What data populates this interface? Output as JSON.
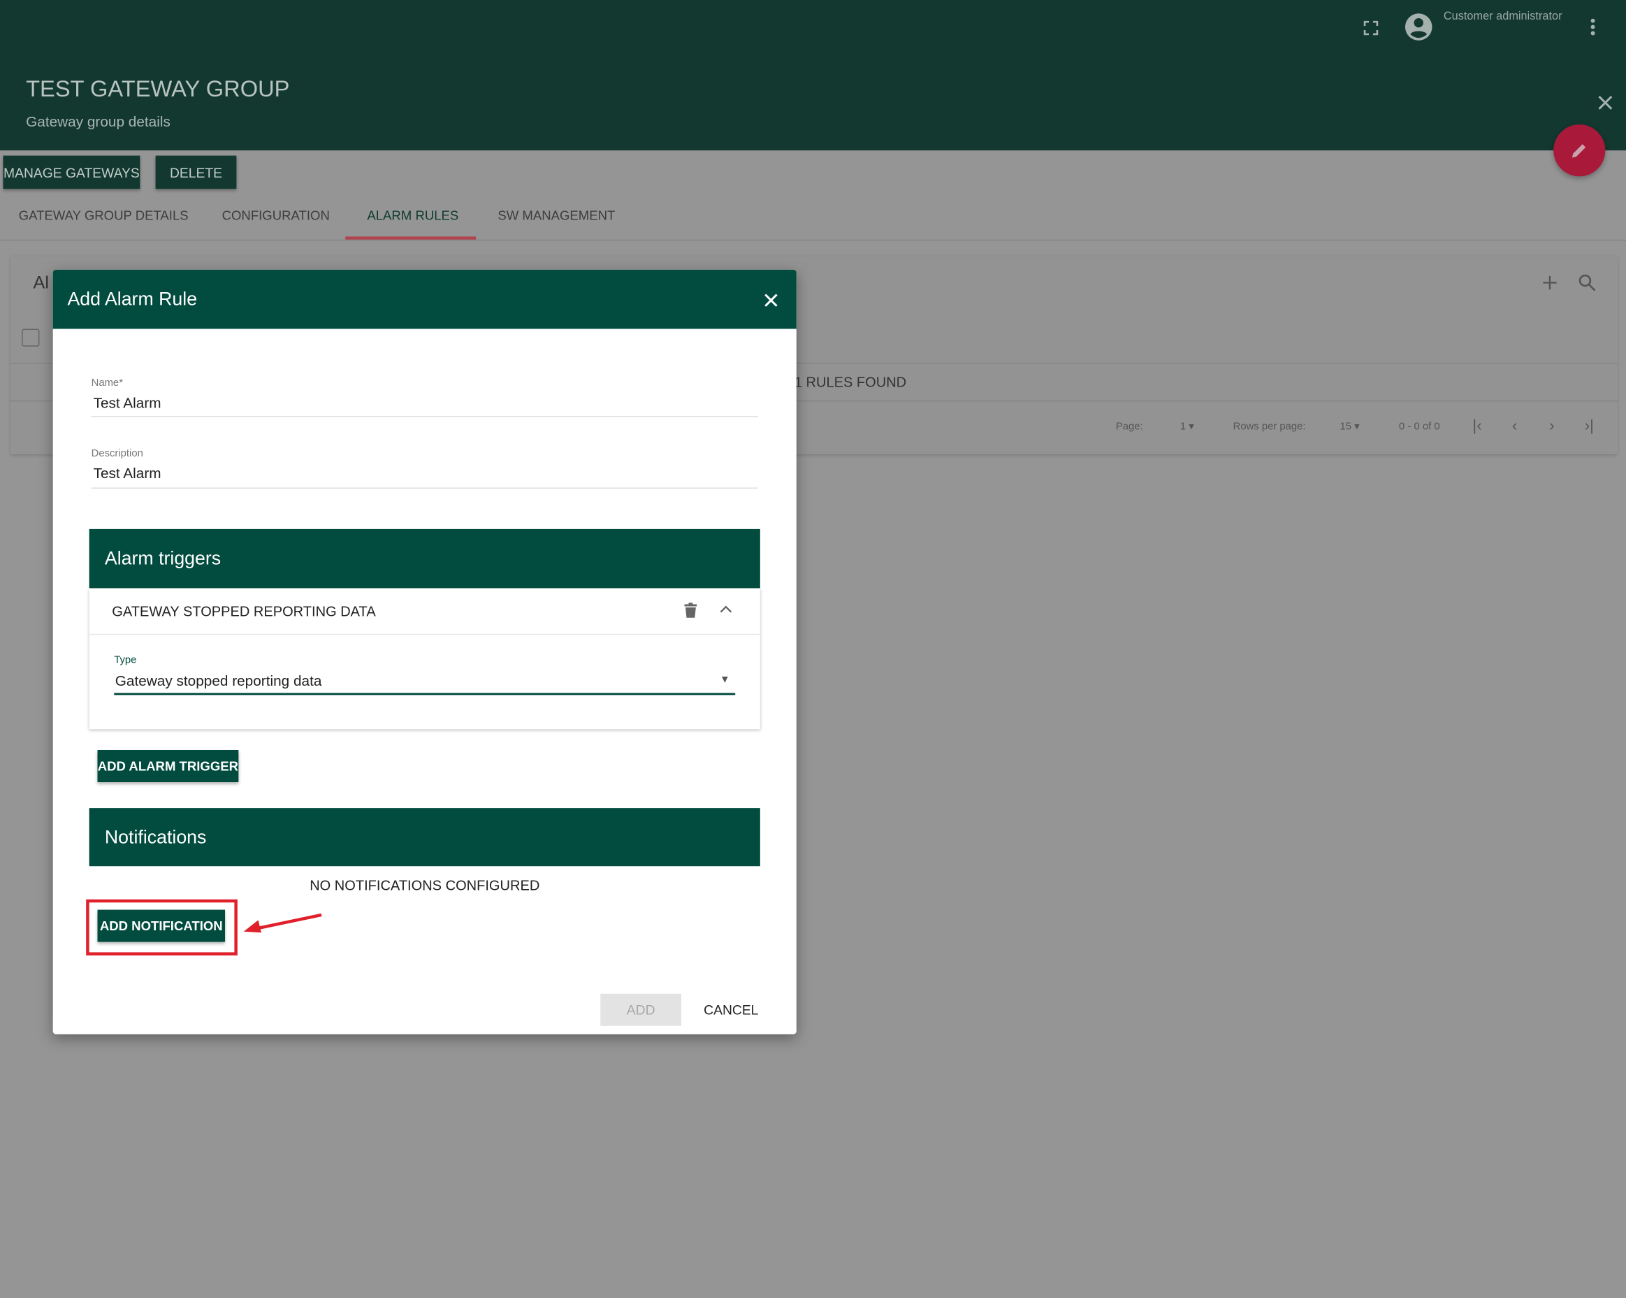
{
  "header": {
    "title": "TEST GATEWAY GROUP",
    "subtitle": "Gateway group details",
    "user": "Customer administrator"
  },
  "actions": {
    "manage_gateways": "MANAGE GATEWAYS",
    "delete": "DELETE"
  },
  "tabs": [
    {
      "label": "GATEWAY GROUP DETAILS"
    },
    {
      "label": "CONFIGURATION"
    },
    {
      "label": "ALARM RULES",
      "active": true
    },
    {
      "label": "SW MANAGEMENT"
    }
  ],
  "card": {
    "title_partial": "Al",
    "rules_found": "1 RULES FOUND"
  },
  "pagination": {
    "page_label": "Page:",
    "page": "1",
    "rows_label": "Rows per page:",
    "rows": "15",
    "range": "0 - 0 of 0"
  },
  "modal": {
    "title": "Add Alarm Rule",
    "name": {
      "label": "Name",
      "required": "*",
      "value": "Test Alarm"
    },
    "description": {
      "label": "Description",
      "value": "Test Alarm"
    },
    "alarm_triggers": {
      "title": "Alarm triggers",
      "items": [
        {
          "name": "GATEWAY STOPPED REPORTING DATA",
          "type_label": "Type",
          "type_value": "Gateway stopped reporting data"
        }
      ],
      "add_label": "ADD ALARM TRIGGER"
    },
    "notifications": {
      "title": "Notifications",
      "empty": "NO NOTIFICATIONS CONFIGURED",
      "add_label": "ADD NOTIFICATION"
    },
    "add_label": "ADD",
    "cancel_label": "CANCEL"
  },
  "colors": {
    "primary": "#024c3f",
    "accent": "#a8193a",
    "highlight": "#e0202b"
  }
}
